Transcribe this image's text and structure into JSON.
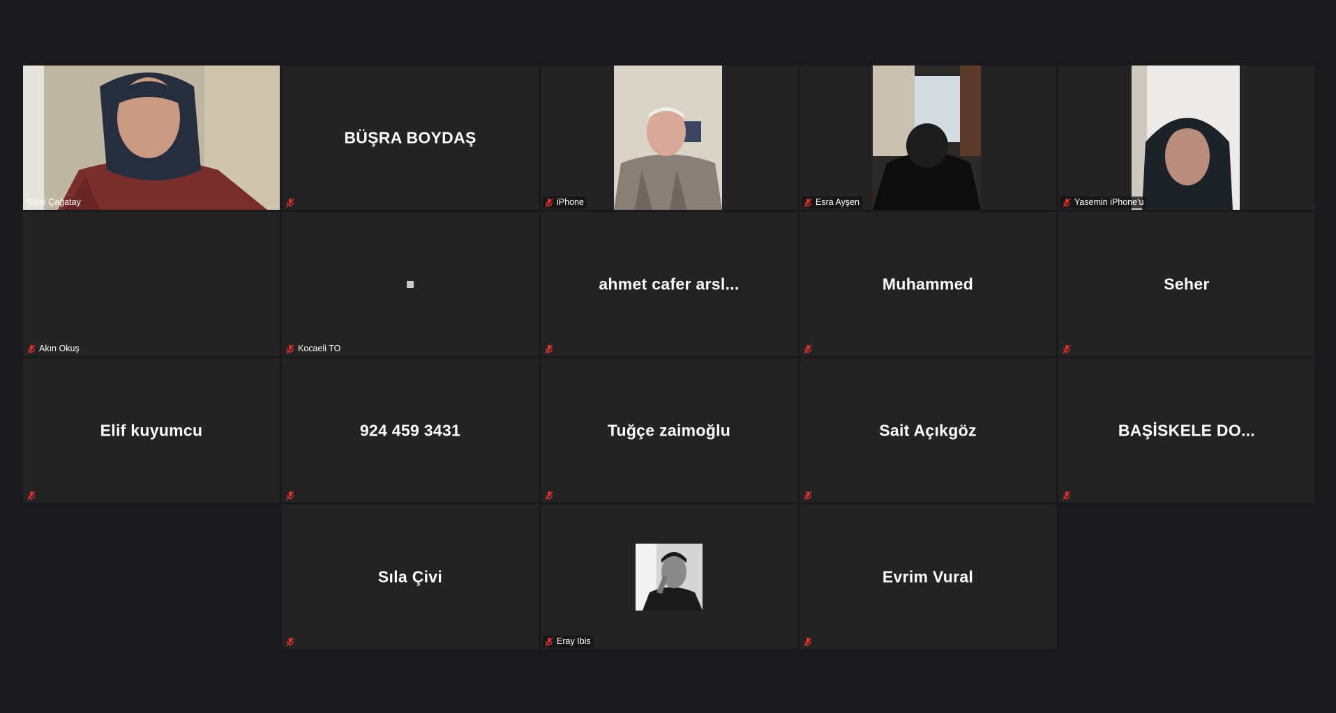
{
  "meeting": {
    "participants": [
      {
        "display_name": "Sibel Çağatay",
        "center_name": "",
        "video": "camera",
        "muted": false,
        "active_speaker": true
      },
      {
        "display_name": "",
        "center_name": "BÜŞRA BOYDAŞ",
        "video": "off",
        "muted": true
      },
      {
        "display_name": "iPhone",
        "center_name": "",
        "video": "camera",
        "muted": true
      },
      {
        "display_name": "Esra Ayşen",
        "center_name": "",
        "video": "camera",
        "muted": true
      },
      {
        "display_name": "Yasemin iPhone'u",
        "center_name": "",
        "video": "camera",
        "muted": true
      },
      {
        "display_name": "Akın Okuş",
        "center_name": "",
        "video": "off",
        "muted": true
      },
      {
        "display_name": "Kocaeli TO",
        "center_name": "",
        "video": "tiny",
        "muted": true
      },
      {
        "display_name": "",
        "center_name": "ahmet  cafer  arsl...",
        "video": "off",
        "muted": true
      },
      {
        "display_name": "",
        "center_name": "Muhammed",
        "video": "off",
        "muted": true
      },
      {
        "display_name": "",
        "center_name": "Seher",
        "video": "off",
        "muted": true
      },
      {
        "display_name": "",
        "center_name": "Elif kuyumcu",
        "video": "off",
        "muted": true
      },
      {
        "display_name": "",
        "center_name": "924 459 3431",
        "video": "off",
        "muted": true
      },
      {
        "display_name": "",
        "center_name": "Tuğçe zaimoğlu",
        "video": "off",
        "muted": true
      },
      {
        "display_name": "",
        "center_name": "Sait Açıkgöz",
        "video": "off",
        "muted": true
      },
      {
        "display_name": "",
        "center_name": "BAŞİSKELE  DO...",
        "video": "off",
        "muted": true
      },
      {
        "display_name": "",
        "center_name": "Sıla Çivi",
        "video": "off",
        "muted": true
      },
      {
        "display_name": "Eray Ibis",
        "center_name": "",
        "video": "avatar",
        "muted": true
      },
      {
        "display_name": "",
        "center_name": "Evrim Vural",
        "video": "off",
        "muted": true
      }
    ]
  },
  "colors": {
    "background": "#1a1a1c",
    "tile": "#232323",
    "active_speaker_border": "#d7e96a",
    "muted_icon": "#e0322e"
  },
  "icons": {
    "muted": "microphone-muted-icon"
  }
}
